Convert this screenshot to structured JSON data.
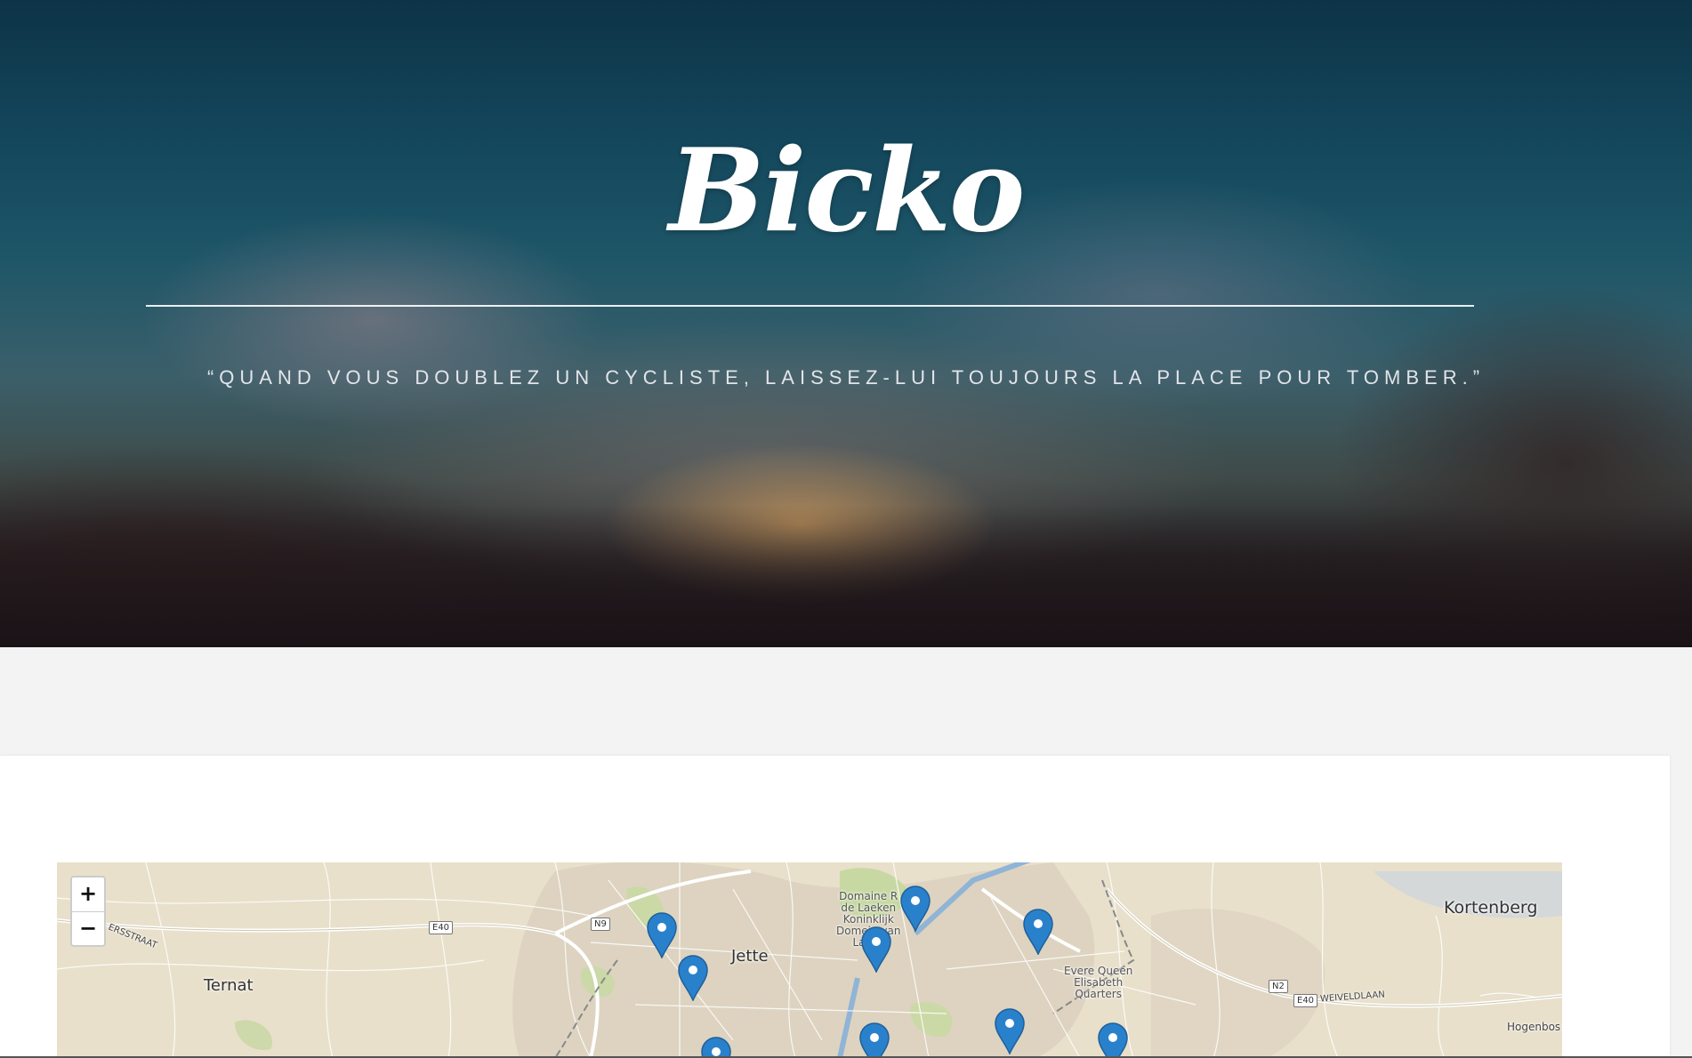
{
  "header": {
    "brand": "Bicko",
    "tagline": "“QUAND VOUS DOUBLEZ UN CYCLISTE, LAISSEZ-LUI TOUJOURS LA PLACE POUR TOMBER.”"
  },
  "map": {
    "zoom_in_label": "+",
    "zoom_out_label": "−",
    "places": {
      "kortenberg": "Kortenberg",
      "jette": "Jette",
      "ternat": "Ternat",
      "ersstraat": "ERSSTRAAT",
      "hogenbos": "Hogenbos",
      "domaine_1": "Domaine R",
      "domaine_2": "de Laeken",
      "domaine_3": "Koninklijk",
      "domaine_4": "Domein van",
      "domaine_5": "Laken",
      "evere_1": "Evere Queen",
      "evere_2": "Elisabeth",
      "evere_3": "Quarters",
      "weiveldlaan": "WEIVELDLAAN"
    },
    "roads": {
      "e40_west": "E40",
      "n9": "N9",
      "n2": "N2",
      "e40_east": "E40"
    },
    "marker_icon": "map-pin-icon",
    "marker_color": "#2a81cb",
    "marker_count": 11
  }
}
